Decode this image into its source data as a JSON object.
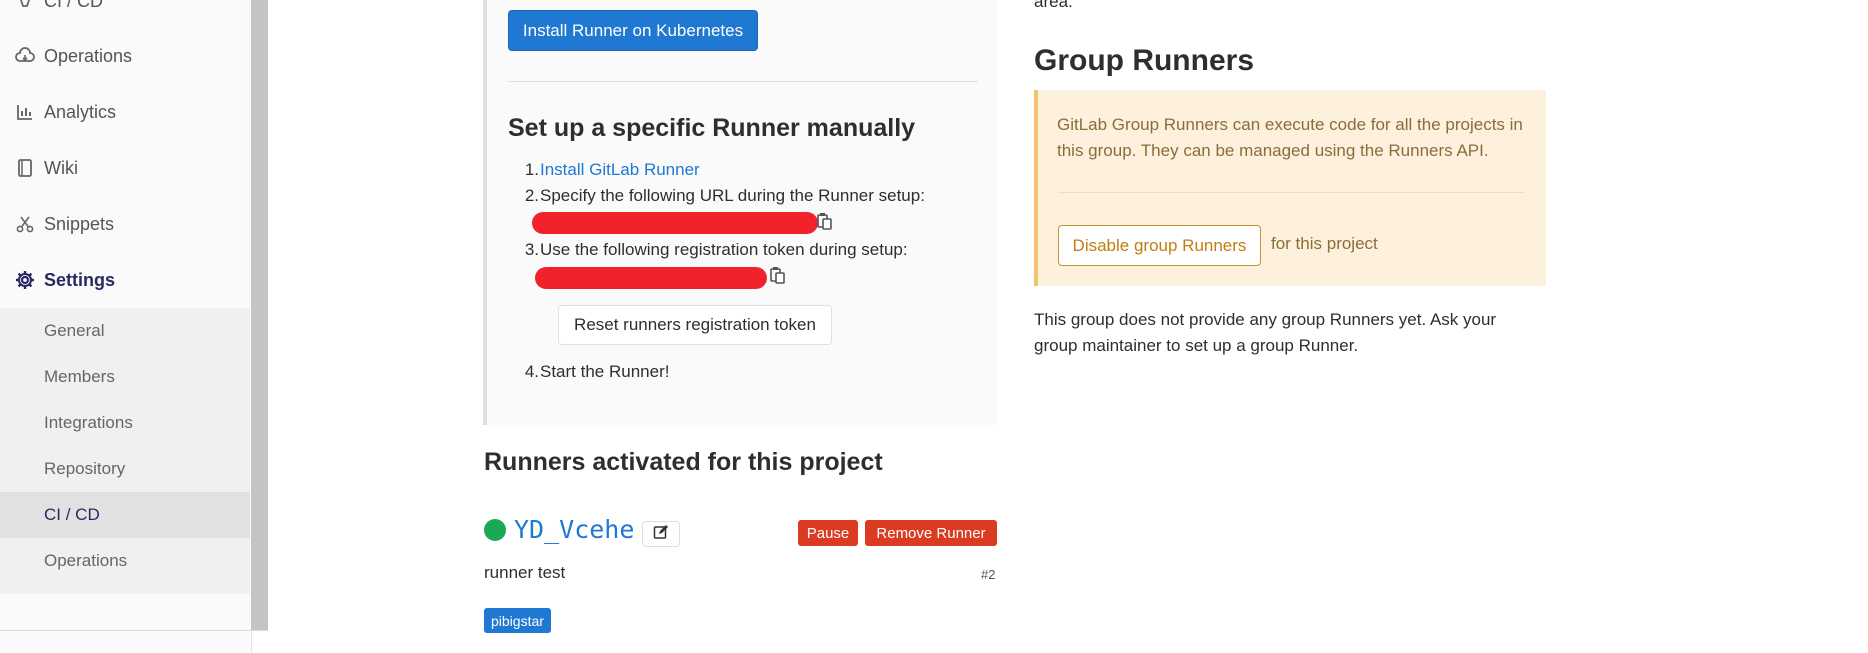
{
  "sidebar": {
    "items": [
      {
        "label": "CI / CD",
        "icon": "rocket-icon"
      },
      {
        "label": "Operations",
        "icon": "cloud-icon"
      },
      {
        "label": "Analytics",
        "icon": "chart-icon"
      },
      {
        "label": "Wiki",
        "icon": "book-icon"
      },
      {
        "label": "Snippets",
        "icon": "scissors-icon"
      },
      {
        "label": "Settings",
        "icon": "gear-icon"
      }
    ],
    "settings_sub": [
      "General",
      "Members",
      "Integrations",
      "Repository",
      "CI / CD",
      "Operations"
    ]
  },
  "setup": {
    "install_k8s_button": "Install Runner on Kubernetes",
    "title": "Set up a specific Runner manually",
    "step1_num": "1.",
    "step1_link": "Install GitLab Runner",
    "step2_num": "2.",
    "step2_text": "Specify the following URL during the Runner setup:",
    "step3_num": "3.",
    "step3_text": "Use the following registration token during setup:",
    "reset_button": "Reset runners registration token",
    "step4_num": "4.",
    "step4_text": "Start the Runner!"
  },
  "activated": {
    "title": "Runners activated for this project",
    "runner_name": "YD_Vcehe",
    "pause_button": "Pause",
    "remove_button": "Remove Runner",
    "description": "runner test",
    "id": "#2",
    "tag": "pibigstar"
  },
  "group": {
    "area_text": "area.",
    "title": "Group Runners",
    "info": "GitLab Group Runners can execute code for all the projects in this group. They can be managed using the Runners API.",
    "disable_button": "Disable group Runners",
    "for_project": "for this project",
    "no_runners": "This group does not provide any group Runners yet. Ask your group maintainer to set up a group Runner."
  },
  "colors": {
    "primary": "#1f78d1",
    "danger": "#db3b21",
    "success": "#1aaa55",
    "warning_bg": "#fdf1dd"
  }
}
